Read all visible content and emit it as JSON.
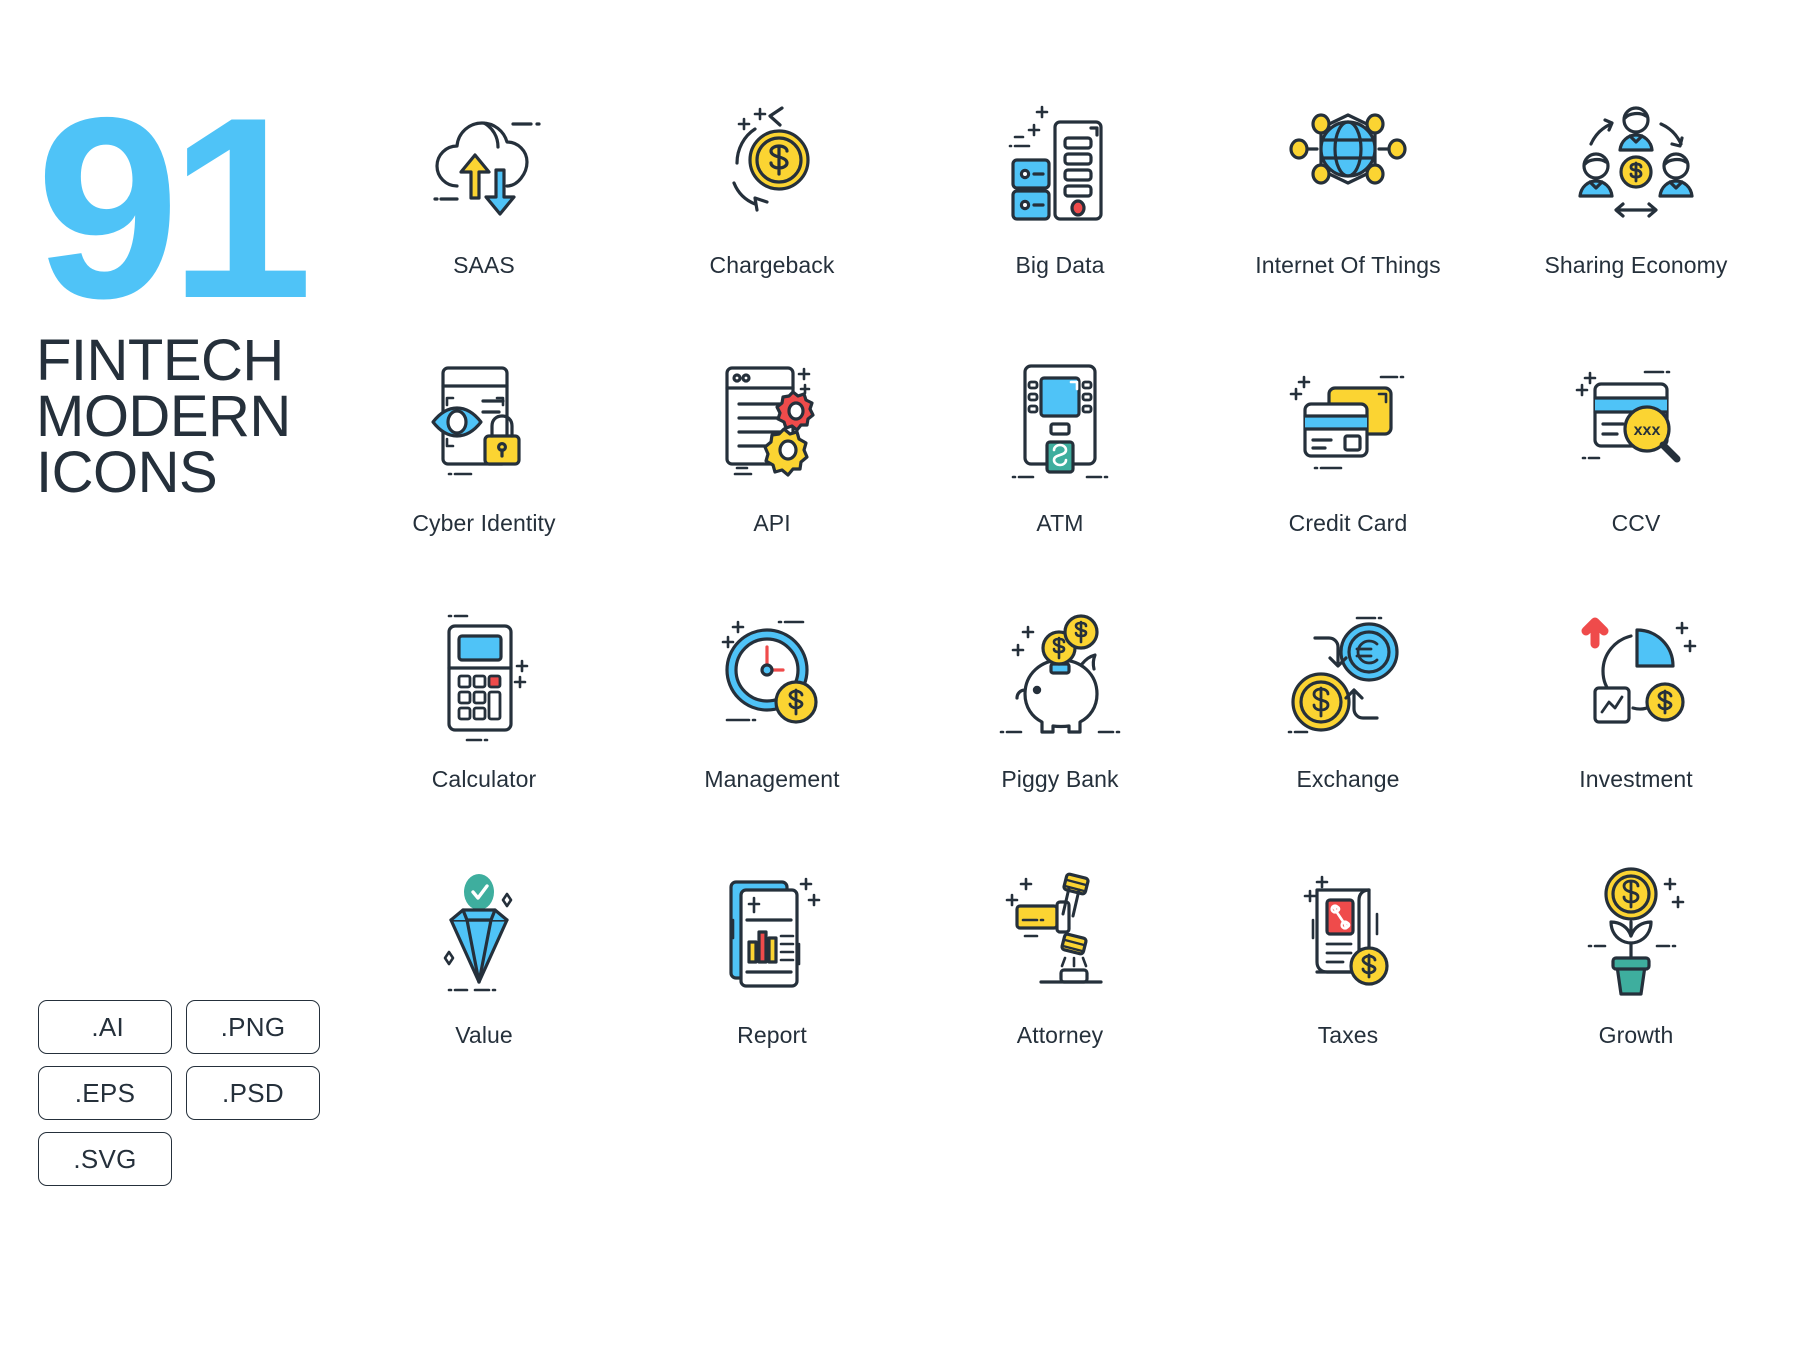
{
  "title": {
    "number": "91",
    "line1": "FINTECH",
    "line2": "MODERN",
    "line3": "ICONS"
  },
  "colors": {
    "accent_blue": "#4FC3F7",
    "dark": "#25303B",
    "yellow": "#FBD432",
    "red": "#EF4B4B",
    "teal": "#3EAE9E",
    "white": "#FFFFFF"
  },
  "formats": [
    [
      " .AI",
      ".PNG"
    ],
    [
      ".EPS",
      ".PSD"
    ],
    [
      ".SVG"
    ]
  ],
  "format_badges": [
    {
      "label": " .AI"
    },
    {
      "label": ".PNG"
    },
    {
      "label": ".EPS"
    },
    {
      "label": ".PSD"
    },
    {
      "label": ".SVG"
    }
  ],
  "grid": {
    "columns": 5,
    "rows": [
      {
        "cells": [
          {
            "label": "SAAS",
            "icon": "cloud-upload-download-icon"
          },
          {
            "label": "Chargeback",
            "icon": "coin-refresh-icon"
          },
          {
            "label": "Big Data",
            "icon": "server-document-icon"
          },
          {
            "label": "Internet Of Things",
            "icon": "globe-network-icon"
          },
          {
            "label": "Sharing Economy",
            "icon": "people-coin-circle-icon"
          }
        ]
      },
      {
        "cells": [
          {
            "label": "Cyber Identity",
            "icon": "eye-scan-lock-icon"
          },
          {
            "label": "API",
            "icon": "browser-gears-icon"
          },
          {
            "label": "ATM",
            "icon": "atm-machine-icon"
          },
          {
            "label": "Credit Card",
            "icon": "credit-cards-icon"
          },
          {
            "label": "CCV",
            "icon": "card-magnifier-ccv-icon"
          }
        ]
      },
      {
        "cells": [
          {
            "label": "Calculator",
            "icon": "calculator-icon"
          },
          {
            "label": "Management",
            "icon": "clock-coin-icon"
          },
          {
            "label": "Piggy Bank",
            "icon": "piggy-bank-icon"
          },
          {
            "label": "Exchange",
            "icon": "currency-exchange-icon"
          },
          {
            "label": "Investment",
            "icon": "pie-chart-coin-icon"
          }
        ]
      },
      {
        "cells": [
          {
            "label": "Value",
            "icon": "diamond-check-icon"
          },
          {
            "label": "Report",
            "icon": "report-chart-icon"
          },
          {
            "label": "Attorney",
            "icon": "gavel-icon"
          },
          {
            "label": "Taxes",
            "icon": "tax-receipt-percent-icon"
          },
          {
            "label": "Growth",
            "icon": "money-plant-growth-icon"
          }
        ]
      }
    ]
  }
}
